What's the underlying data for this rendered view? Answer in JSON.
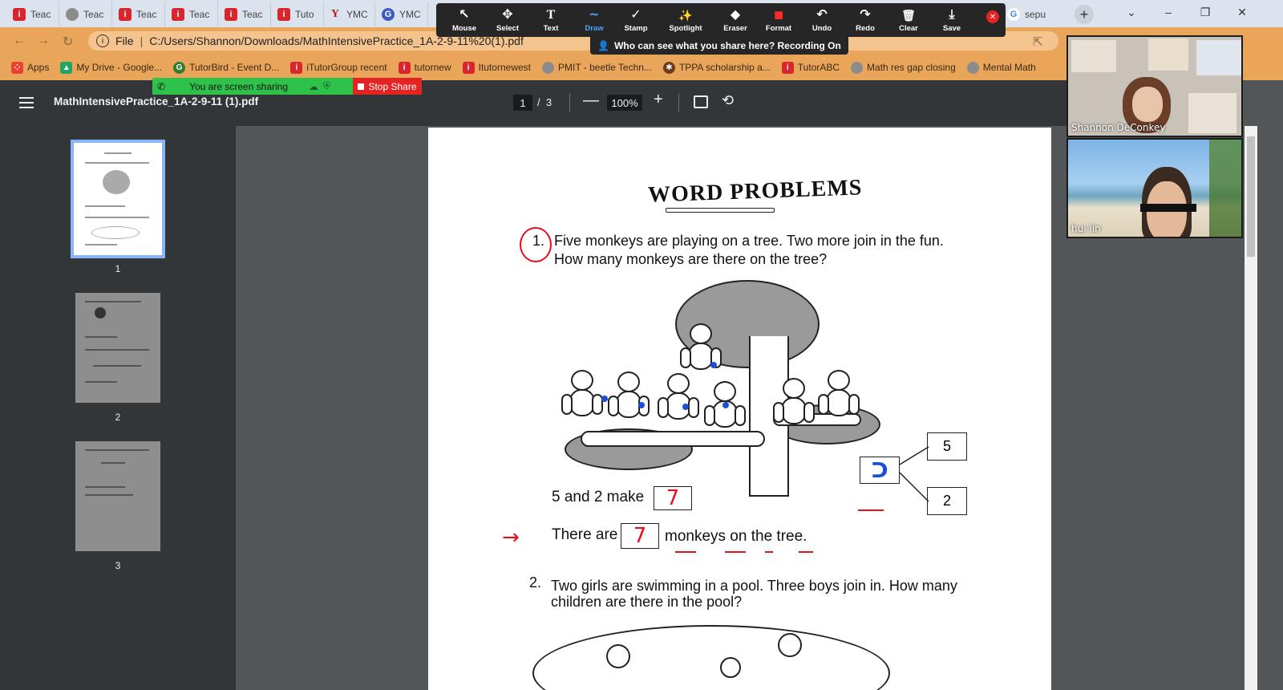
{
  "browser": {
    "tabs": [
      {
        "label": "Teac",
        "icon": "itutor-icon"
      },
      {
        "label": "Teac",
        "icon": "globe-icon"
      },
      {
        "label": "Teac",
        "icon": "itutor-icon"
      },
      {
        "label": "Teac",
        "icon": "itutor-icon"
      },
      {
        "label": "Teac",
        "icon": "itutor-icon"
      },
      {
        "label": "Tuto",
        "icon": "itutor-icon"
      },
      {
        "label": "YMC",
        "icon": "y-icon"
      },
      {
        "label": "YMC",
        "icon": "g-icon"
      },
      {
        "label": "sepu",
        "icon": "google-icon"
      }
    ],
    "new_tab": "+",
    "address": {
      "scheme": "File",
      "url": "C:/Users/Shannon/Downloads/MathIntensivePractice_1A-2-9-11%20(1).pdf"
    },
    "bookmarks": [
      {
        "label": "Apps",
        "icon": "apps-icon",
        "color": "#e94235"
      },
      {
        "label": "My Drive - Google...",
        "icon": "drive-icon",
        "color": "#1fa463"
      },
      {
        "label": "TutorBird - Event D...",
        "icon": "tutorbird-icon",
        "color": "#2e7d32"
      },
      {
        "label": "iTutorGroup recent",
        "icon": "itutor-icon",
        "color": "#d9262c"
      },
      {
        "label": "tutornew",
        "icon": "itutor-icon",
        "color": "#d9262c"
      },
      {
        "label": "Itutornewest",
        "icon": "itutor-icon",
        "color": "#d9262c"
      },
      {
        "label": "PMIT - beetle Techn...",
        "icon": "globe-icon",
        "color": "#8c8c8c"
      },
      {
        "label": "TPPA scholarship a...",
        "icon": "tppa-icon",
        "color": "#6b3b1a"
      },
      {
        "label": "TutorABC",
        "icon": "itutor-icon",
        "color": "#d9262c"
      },
      {
        "label": "Math res gap closing",
        "icon": "globe-icon",
        "color": "#8c8c8c"
      },
      {
        "label": "Mental Math",
        "icon": "globe-icon",
        "color": "#8c8c8c"
      }
    ]
  },
  "zoom": {
    "tools": [
      {
        "label": "Mouse",
        "icon": "cursor-icon",
        "glyph": "↖"
      },
      {
        "label": "Select",
        "icon": "move-icon",
        "glyph": "✥"
      },
      {
        "label": "Text",
        "icon": "text-icon",
        "glyph": "T"
      },
      {
        "label": "Draw",
        "icon": "draw-icon",
        "glyph": "∼"
      },
      {
        "label": "Stamp",
        "icon": "check-icon",
        "glyph": "✓"
      },
      {
        "label": "Spotlight",
        "icon": "spotlight-icon",
        "glyph": "✨"
      },
      {
        "label": "Eraser",
        "icon": "eraser-icon",
        "glyph": "◆"
      },
      {
        "label": "Format",
        "icon": "format-icon",
        "glyph": "■"
      },
      {
        "label": "Undo",
        "icon": "undo-icon",
        "glyph": "↶"
      },
      {
        "label": "Redo",
        "icon": "redo-icon",
        "glyph": "↷"
      },
      {
        "label": "Clear",
        "icon": "trash-icon",
        "glyph": "🗑"
      },
      {
        "label": "Save",
        "icon": "save-icon",
        "glyph": "⤓"
      }
    ],
    "active_tool": "Draw",
    "share_banner": "Who can see what you share here? Recording On",
    "sharing_status": "You are screen sharing",
    "stop_share": "Stop Share",
    "participants": [
      {
        "name": "Shannon DeConkey"
      },
      {
        "name": "hui lin"
      }
    ],
    "colors": {
      "accent": "#4ea3ff",
      "sharing": "#2fc24a",
      "stop": "#e42323"
    }
  },
  "pdf": {
    "filename": "MathIntensivePractice_1A-2-9-11 (1).pdf",
    "current_page": "1",
    "page_sep": "/",
    "total_pages": "3",
    "zoom": "100%",
    "minus": "—",
    "plus": "+",
    "thumbnails": [
      {
        "number": "1",
        "selected": true
      },
      {
        "number": "2",
        "selected": false
      },
      {
        "number": "3",
        "selected": false
      }
    ],
    "page": {
      "title": "WORD PROBLEMS",
      "q1": {
        "number": "1.",
        "line1": "Five monkeys are playing on a tree. Two more join in the fun.",
        "line2": "How many monkeys are there on the tree?",
        "make_prefix": "5 and 2 make",
        "make_answer": "7",
        "there_prefix": "There are",
        "there_answer": "7",
        "there_suffix": "monkeys on the tree.",
        "box_top": "5",
        "box_bottom": "2"
      },
      "q2": {
        "number": "2.",
        "line1": "Two girls are swimming in a pool. Three boys join in. How many",
        "line2": "children are there in the pool?"
      },
      "annotation_color": "#e8101b",
      "pen_color": "#1a4fd6"
    }
  }
}
